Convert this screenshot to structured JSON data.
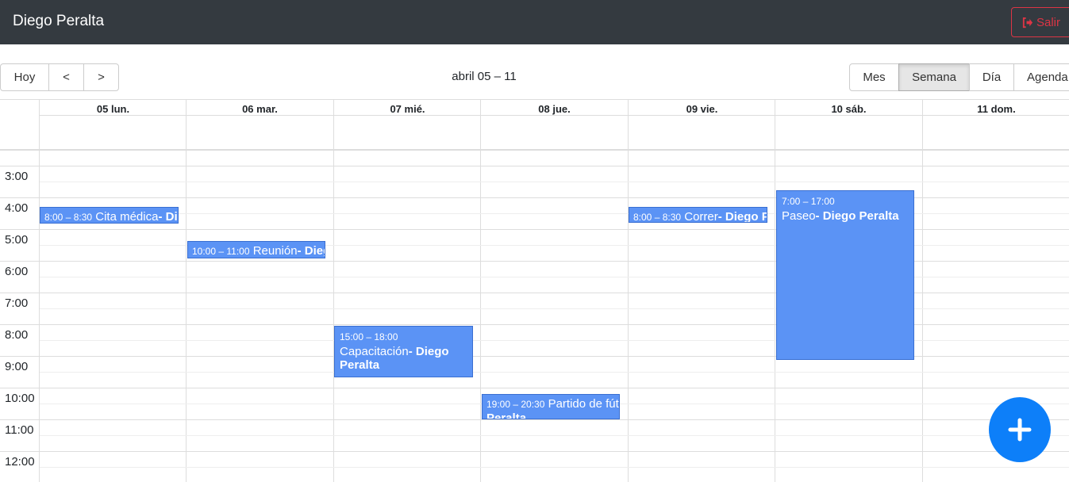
{
  "navbar": {
    "brand": "Diego Peralta",
    "logout_label": "Salir",
    "logout_icon": "sign-out-icon"
  },
  "toolbar": {
    "nav": {
      "today": "Hoy",
      "prev": "<",
      "next": ">"
    },
    "title": "abril 05 – 11",
    "views": {
      "month": "Mes",
      "week": "Semana",
      "day": "Día",
      "agenda": "Agenda"
    },
    "active_view": "Semana"
  },
  "days": [
    "05 lun.",
    "06 mar.",
    "07 mié.",
    "08 jue.",
    "09 vie.",
    "10 sáb.",
    "11 dom."
  ],
  "times": [
    "3:00",
    "4:00",
    "5:00",
    "6:00",
    "7:00",
    "8:00",
    "9:00",
    "10:00",
    "11:00",
    "12:00"
  ],
  "events": [
    {
      "time": "8:00 – 8:30",
      "title": "Cita médica",
      "user": "Diego Peralta",
      "separator": "- "
    },
    {
      "time": "10:00 – 11:00",
      "title": "Reunión",
      "user": "Diego Peralta",
      "separator": "- "
    },
    {
      "time": "15:00 – 18:00",
      "title": "Capacitación",
      "user": "Diego Peralta",
      "separator": "- "
    },
    {
      "time": "19:00 – 20:30",
      "title": "Partido de fútbol",
      "user": "Diego Peralta",
      "separator": "- "
    },
    {
      "time": "8:00 – 8:30",
      "title": "Correr",
      "user": "Diego Peralta",
      "separator": "- "
    },
    {
      "time": "7:00 – 17:00",
      "title": "Paseo",
      "user": "Diego Peralta",
      "separator": "- "
    }
  ],
  "fab": {
    "icon": "plus-icon"
  },
  "colors": {
    "navbar": "#343a40",
    "event": "#5b93f5",
    "fab": "#0d7ff9",
    "logout": "#dc3545"
  }
}
